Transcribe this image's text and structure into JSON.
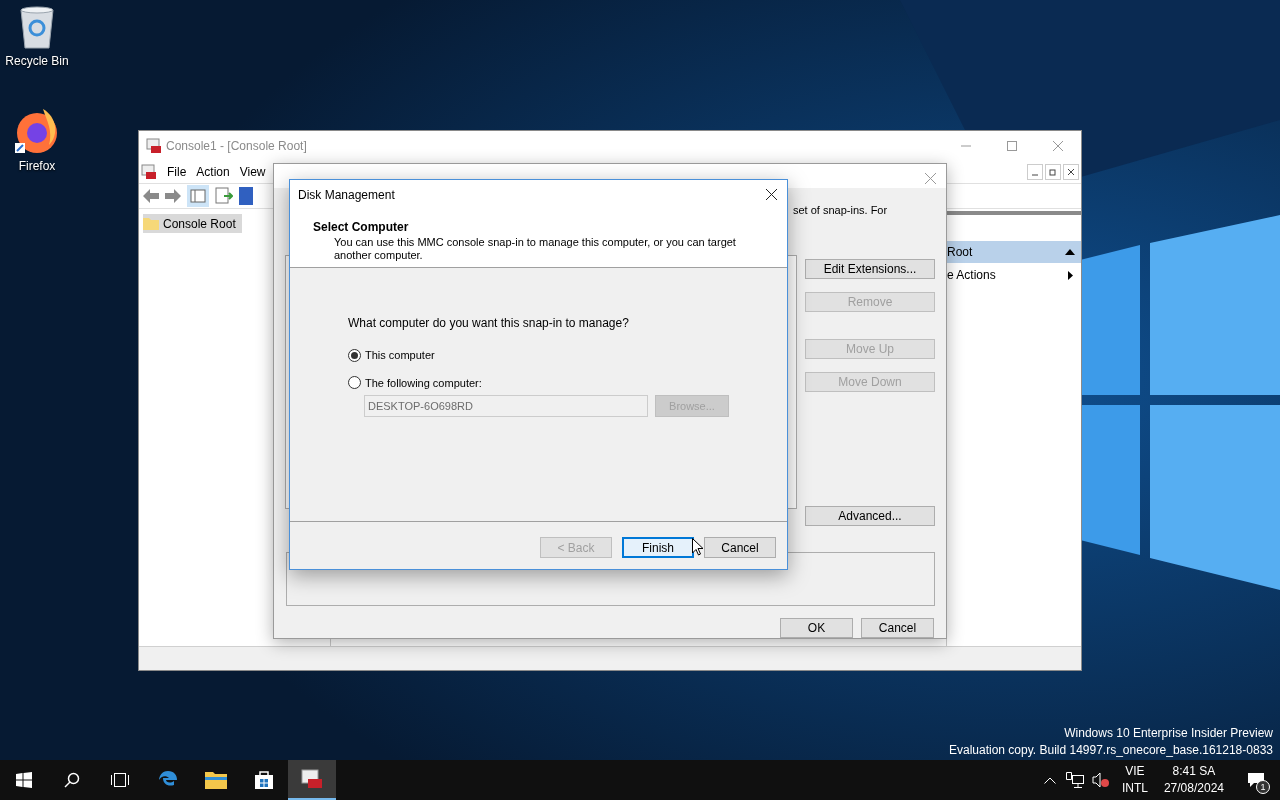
{
  "desktop": {
    "icons": [
      {
        "label": "Recycle Bin",
        "kind": "recycle"
      },
      {
        "label": "Firefox",
        "kind": "firefox"
      }
    ],
    "watermark": [
      "Windows 10 Enterprise Insider Preview",
      "Evaluation copy. Build 14997.rs_onecore_base.161218-0833"
    ]
  },
  "console": {
    "title": "Console1 - [Console Root]",
    "menu": [
      "File",
      "Action",
      "View"
    ],
    "tree": [
      {
        "label": "Console Root",
        "selected": true
      }
    ],
    "actions": {
      "header": "Root",
      "items": [
        "e Actions"
      ]
    }
  },
  "snapins": {
    "intro": "set of snap-ins. For",
    "buttons": [
      {
        "label": "Edit Extensions...",
        "disabled": false
      },
      {
        "label": "Remove",
        "disabled": true
      },
      {
        "label": "Move Up",
        "disabled": true
      },
      {
        "label": "Move Down",
        "disabled": true
      }
    ],
    "advanced": "Advanced...",
    "footer": [
      "OK",
      "Cancel"
    ]
  },
  "dialog": {
    "title": "Disk Management",
    "heading": "Select Computer",
    "description": "You can use this MMC console snap-in to manage this computer, or you can target another computer.",
    "question": "What computer do you want this snap-in to manage?",
    "options": [
      {
        "label": "This computer",
        "selected": true
      },
      {
        "label": "The following computer:",
        "selected": false
      }
    ],
    "computer": {
      "value": "DESKTOP-6O698RD",
      "disabled": true
    },
    "browse": {
      "label": "Browse...",
      "disabled": true
    },
    "buttons": [
      {
        "label": "< Back",
        "disabled": true,
        "default": false
      },
      {
        "label": "Finish",
        "disabled": false,
        "default": true
      },
      {
        "label": "Cancel",
        "disabled": false,
        "default": false
      }
    ]
  },
  "taskbar": {
    "apps": [
      {
        "kind": "start",
        "selected": false
      },
      {
        "kind": "search",
        "selected": false
      },
      {
        "kind": "taskview",
        "selected": false
      },
      {
        "kind": "edge",
        "selected": false
      },
      {
        "kind": "explorer",
        "selected": false
      },
      {
        "kind": "store",
        "selected": false
      },
      {
        "kind": "mmc",
        "selected": true
      }
    ],
    "language": [
      "VIE",
      "INTL"
    ],
    "time": "8:41 SA",
    "date": "27/08/2024",
    "notifications": "1"
  }
}
